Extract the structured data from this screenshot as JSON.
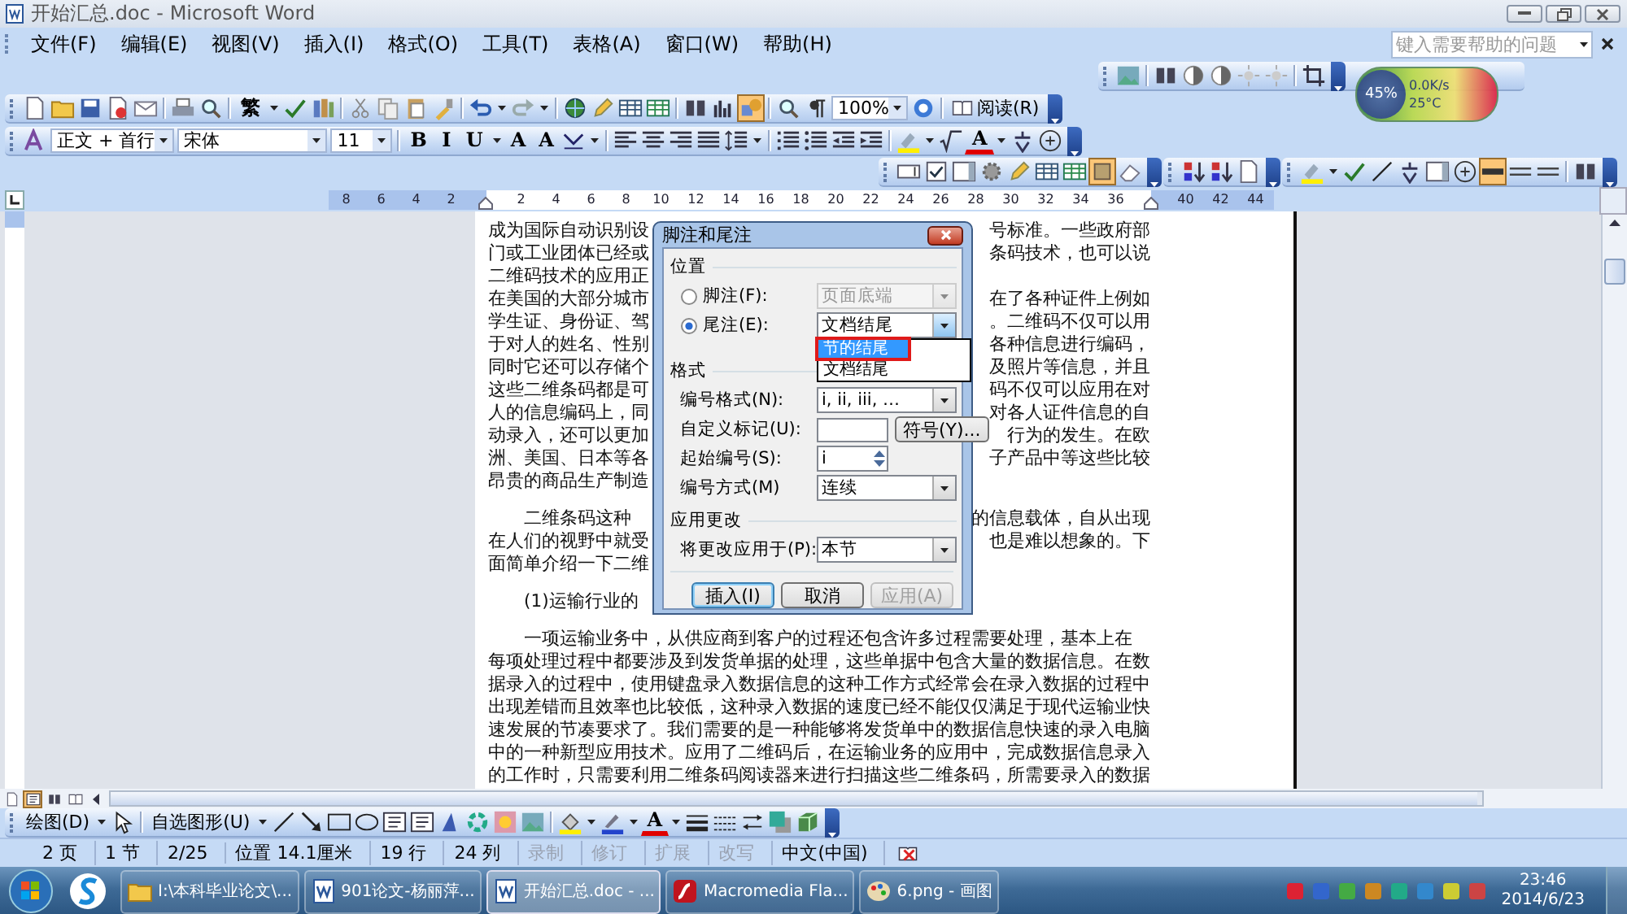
{
  "window": {
    "title": "开始汇总.doc - Microsoft Word"
  },
  "menu": [
    "文件(F)",
    "编辑(E)",
    "视图(V)",
    "插入(I)",
    "格式(O)",
    "工具(T)",
    "表格(A)",
    "窗口(W)",
    "帮助(H)"
  ],
  "help_box": {
    "placeholder": "键入需要帮助的问题"
  },
  "toolbars": {
    "picture": [
      {
        "kind": "icon",
        "on": false
      },
      {
        "kind": "sep"
      },
      {
        "kind": "icon",
        "on": false
      },
      {
        "kind": "icon",
        "on": false
      },
      {
        "kind": "icon",
        "on": false
      },
      {
        "kind": "icon",
        "on": false
      },
      {
        "kind": "icon",
        "on": false
      },
      {
        "kind": "sep"
      },
      {
        "kind": "icon",
        "on": false
      }
    ],
    "standard": [
      {
        "kind": "icon",
        "on": false
      },
      {
        "kind": "icon",
        "on": false
      },
      {
        "kind": "icon",
        "on": false
      },
      {
        "kind": "icon",
        "on": false
      },
      {
        "kind": "icon",
        "on": false
      },
      {
        "kind": "sep"
      },
      {
        "kind": "icon",
        "on": false
      },
      {
        "kind": "icon",
        "on": false
      },
      {
        "kind": "sep"
      },
      {
        "kind": "glyph",
        "label": "繁"
      },
      {
        "kind": "arrow"
      },
      {
        "kind": "icon",
        "on": false
      },
      {
        "kind": "icon",
        "on": false
      },
      {
        "kind": "sep"
      },
      {
        "kind": "icon",
        "on": false
      },
      {
        "kind": "icon",
        "on": false
      },
      {
        "kind": "icon",
        "on": false
      },
      {
        "kind": "icon",
        "on": false
      },
      {
        "kind": "sep"
      },
      {
        "kind": "icon",
        "on": false
      },
      {
        "kind": "arrow"
      },
      {
        "kind": "icon",
        "on": false
      },
      {
        "kind": "arrow"
      },
      {
        "kind": "sep"
      },
      {
        "kind": "icon",
        "on": false
      },
      {
        "kind": "icon",
        "on": false
      },
      {
        "kind": "icon",
        "on": false
      },
      {
        "kind": "icon",
        "on": false
      },
      {
        "kind": "sep"
      },
      {
        "kind": "icon",
        "on": false
      },
      {
        "kind": "icon",
        "on": false
      },
      {
        "kind": "icon",
        "on": true
      },
      {
        "kind": "sep"
      },
      {
        "kind": "icon",
        "on": false
      },
      {
        "kind": "icon",
        "on": false
      },
      {
        "kind": "dropdown",
        "value": "100%"
      },
      {
        "kind": "icon",
        "on": false
      },
      {
        "kind": "sep"
      },
      {
        "kind": "label",
        "label": "阅读(R)"
      }
    ],
    "formatting": [
      {
        "kind": "icon",
        "on": false
      },
      {
        "kind": "dropdown",
        "value": "正文 + 首行"
      },
      {
        "kind": "dropdown",
        "value": "宋体"
      },
      {
        "kind": "dropdown",
        "value": "11"
      },
      {
        "kind": "sep"
      },
      {
        "kind": "glyph",
        "label": "B"
      },
      {
        "kind": "glyph",
        "label": "I"
      },
      {
        "kind": "glyph",
        "label": "U"
      },
      {
        "kind": "arrow"
      },
      {
        "kind": "glyph",
        "label": "A"
      },
      {
        "kind": "glyph",
        "label": "A"
      },
      {
        "kind": "icon",
        "on": false
      },
      {
        "kind": "arrow"
      },
      {
        "kind": "sep"
      },
      {
        "kind": "icon",
        "on": false
      },
      {
        "kind": "icon",
        "on": false
      },
      {
        "kind": "icon",
        "on": false
      },
      {
        "kind": "icon",
        "on": false
      },
      {
        "kind": "icon",
        "on": false
      },
      {
        "kind": "arrow"
      },
      {
        "kind": "sep"
      },
      {
        "kind": "icon",
        "on": false
      },
      {
        "kind": "icon",
        "on": false
      },
      {
        "kind": "icon",
        "on": false
      },
      {
        "kind": "icon",
        "on": false
      },
      {
        "kind": "sep"
      },
      {
        "kind": "icon",
        "on": false
      },
      {
        "kind": "arrow"
      },
      {
        "kind": "icon",
        "on": false
      },
      {
        "kind": "color-glyph",
        "label": "A"
      },
      {
        "kind": "arrow"
      },
      {
        "kind": "icon",
        "on": false
      },
      {
        "kind": "icon",
        "on": false
      }
    ],
    "forms": [
      {
        "kind": "icon",
        "on": false
      },
      {
        "kind": "icon",
        "on": false
      },
      {
        "kind": "icon",
        "on": false
      },
      {
        "kind": "icon",
        "on": false
      },
      {
        "kind": "icon",
        "on": false
      },
      {
        "kind": "icon",
        "on": false
      },
      {
        "kind": "icon",
        "on": false
      },
      {
        "kind": "icon",
        "on": true
      },
      {
        "kind": "icon",
        "on": false
      }
    ],
    "sort": [
      {
        "kind": "icon",
        "on": false
      },
      {
        "kind": "icon",
        "on": false
      },
      {
        "kind": "icon",
        "on": false
      }
    ],
    "reviewing": [
      {
        "kind": "icon",
        "on": false
      },
      {
        "kind": "arrow"
      },
      {
        "kind": "icon",
        "on": false
      },
      {
        "kind": "icon",
        "on": false
      },
      {
        "kind": "icon",
        "on": false
      },
      {
        "kind": "icon",
        "on": false
      },
      {
        "kind": "icon",
        "on": false
      },
      {
        "kind": "icon",
        "on": true
      },
      {
        "kind": "icon",
        "on": false
      },
      {
        "kind": "icon",
        "on": false
      },
      {
        "kind": "sep"
      },
      {
        "kind": "icon",
        "on": false
      }
    ],
    "drawing": [
      {
        "kind": "label",
        "label": "绘图(D)"
      },
      {
        "kind": "arrow"
      },
      {
        "kind": "icon",
        "on": false
      },
      {
        "kind": "sep"
      },
      {
        "kind": "label",
        "label": "自选图形(U)"
      },
      {
        "kind": "arrow"
      },
      {
        "kind": "icon",
        "on": false
      },
      {
        "kind": "icon",
        "on": false
      },
      {
        "kind": "icon",
        "on": false
      },
      {
        "kind": "icon",
        "on": false
      },
      {
        "kind": "icon",
        "on": false
      },
      {
        "kind": "icon",
        "on": false
      },
      {
        "kind": "icon",
        "on": false
      },
      {
        "kind": "icon",
        "on": false
      },
      {
        "kind": "icon",
        "on": false
      },
      {
        "kind": "icon",
        "on": false
      },
      {
        "kind": "sep"
      },
      {
        "kind": "icon",
        "on": false
      },
      {
        "kind": "arrow"
      },
      {
        "kind": "icon",
        "on": false
      },
      {
        "kind": "arrow"
      },
      {
        "kind": "color-glyph",
        "label": "A"
      },
      {
        "kind": "arrow"
      },
      {
        "kind": "icon",
        "on": false
      },
      {
        "kind": "icon",
        "on": false
      },
      {
        "kind": "icon",
        "on": false
      },
      {
        "kind": "icon",
        "on": false
      },
      {
        "kind": "icon",
        "on": false
      }
    ]
  },
  "net_widget": {
    "percent": "45%",
    "speed": "0.0K/s",
    "temperature": "25°C"
  },
  "ruler": [
    "8",
    "6",
    "4",
    "2",
    "2",
    "4",
    "6",
    "8",
    "10",
    "12",
    "14",
    "16",
    "18",
    "20",
    "22",
    "24",
    "26",
    "28",
    "30",
    "32",
    "34",
    "36",
    "40",
    "42",
    "44"
  ],
  "document": {
    "paragraphs": [
      {
        "lines": [
          {
            "left": "成为国际自动识别设",
            "right": "号标准。一些政府部"
          },
          {
            "left": "门或工业团体已经或",
            "right": "条码技术，也可以说"
          },
          {
            "left": "二维码技术的应用正"
          },
          {
            "left": "在美国的大部分城市",
            "right": "在了各种证件上例如"
          },
          {
            "left": "学生证、身份证、驾",
            "right": "。二维码不仅可以用"
          },
          {
            "left": "于对人的姓名、性别",
            "right": "各种信息进行编码，"
          },
          {
            "left": "同时它还可以存储个",
            "right": "及照片等信息，并且"
          },
          {
            "left": "这些二维条码都是可",
            "right": "码不仅可以应用在对"
          },
          {
            "left": "人的信息编码上，同",
            "right": "对各人证件信息的自"
          },
          {
            "left": "动录入，还可以更加",
            "right": "行为的发生。在欧"
          },
          {
            "left": "洲、美国、日本等各",
            "right": "子产品中等这些比较"
          },
          {
            "left": "昂贵的商品生产制造"
          }
        ]
      },
      {
        "lines": [
          {
            "left": "二维条码这种",
            "right": "的信息载体，自从出现"
          },
          {
            "left": "在人们的视野中就受",
            "right": "也是难以想象的。下"
          },
          {
            "left": "面简单介绍一下二维"
          }
        ]
      },
      {
        "lines": [
          {
            "left": "(1)运输行业的"
          }
        ]
      },
      {
        "lines": [
          {
            "left": "一项运输业务中，从供应商到客户的过程还包含许多过程需要处理，基本上在"
          },
          {
            "left": "每项处理过程中都要涉及到发货单据的处理，这些单据中包含大量的数据信息。在数"
          },
          {
            "left": "据录入的过程中，使用键盘录入数据信息的这种工作方式经常会在录入数据的过程中"
          },
          {
            "left": "出现差错而且效率也比较低，这种录入数据的速度已经不能仅仅满足于现代运输业快"
          },
          {
            "left": "速发展的节凑要求了。我们需要的是一种能够将发货单中的数据信息快速的录入电脑"
          },
          {
            "left": "中的一种新型应用技术。应用了二维码后，在运输业务的应用中，完成数据信息录入"
          },
          {
            "left": "的工作时，只需要利用二维条码阅读器来进行扫描这些二维条码，所需要录入的数据"
          }
        ]
      }
    ]
  },
  "dialog": {
    "title": "脚注和尾注",
    "position_heading": "位置",
    "location": [
      {
        "label": "脚注(F):",
        "selected": false,
        "value": "页面底端",
        "disabled": true
      },
      {
        "label": "尾注(E):",
        "selected": true,
        "value": "文档结尾",
        "disabled": false
      }
    ],
    "open_list": [
      {
        "label": "节的结尾",
        "selected": true,
        "marked": true
      },
      {
        "label": "文档结尾",
        "selected": false,
        "marked": false
      }
    ],
    "format_heading": "格式",
    "number_format": {
      "label": "编号格式(N):",
      "value": "i, ii, iii, …"
    },
    "custom_mark": {
      "label": "自定义标记(U):",
      "button": "符号(Y)..."
    },
    "start_at": {
      "label": "起始编号(S):",
      "value": "i"
    },
    "numbering": {
      "label": "编号方式(M)",
      "value": "连续"
    },
    "apply_heading": "应用更改",
    "apply_to": {
      "label": "将更改应用于(P):",
      "value": "本节"
    },
    "buttons": [
      {
        "label": "插入(I)",
        "default": true,
        "disabled": false
      },
      {
        "label": "取消",
        "default": false,
        "disabled": false
      },
      {
        "label": "应用(A)",
        "default": false,
        "disabled": true
      }
    ]
  },
  "status_bar": [
    {
      "label": "2 页",
      "disabled": false
    },
    {
      "label": "1 节",
      "disabled": false
    },
    {
      "label": "2/25",
      "disabled": false
    },
    {
      "label": "位置 14.1厘米",
      "disabled": false
    },
    {
      "label": "19 行",
      "disabled": false
    },
    {
      "label": "24 列",
      "disabled": false
    },
    {
      "label": "录制",
      "disabled": true
    },
    {
      "label": "修订",
      "disabled": true
    },
    {
      "label": "扩展",
      "disabled": true
    },
    {
      "label": "改写",
      "disabled": true
    },
    {
      "label": "中文(中国)",
      "disabled": false
    }
  ],
  "taskbar": {
    "tasks": [
      {
        "label": "I:\\本科毕业论文\\...",
        "selected": false
      },
      {
        "label": "901论文-杨丽萍...",
        "selected": false
      },
      {
        "label": "开始汇总.doc - ...",
        "selected": true
      },
      {
        "label": "Macromedia Fla...",
        "selected": false
      },
      {
        "label": "6.png - 画图",
        "selected": false
      }
    ],
    "time": "23:46",
    "date": "2014/6/23"
  }
}
